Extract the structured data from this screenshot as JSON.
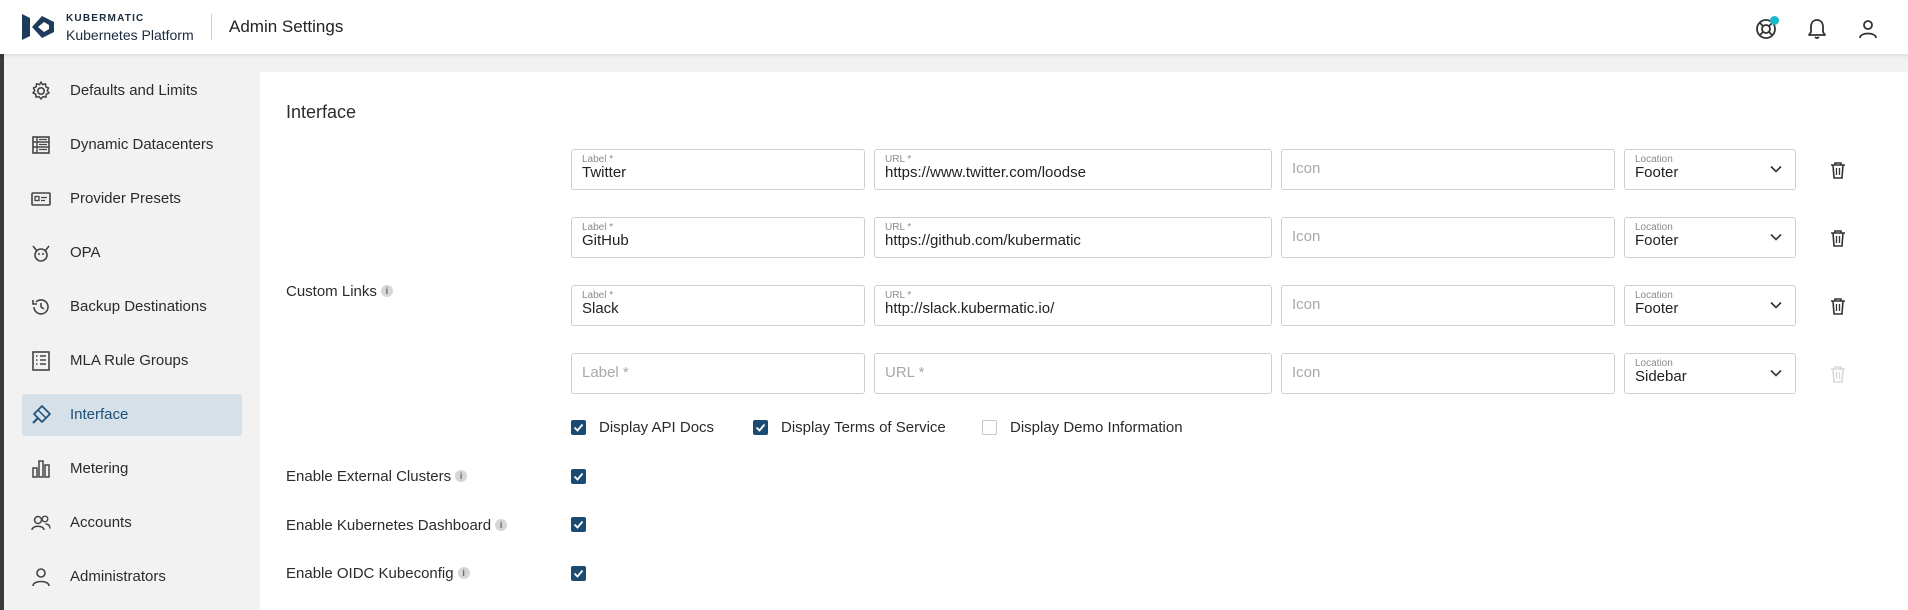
{
  "header": {
    "brand_top": "KUBERMATIC",
    "brand_bottom": "Kubernetes Platform",
    "title": "Admin Settings",
    "icons": [
      "help-icon",
      "notifications-icon",
      "account-icon"
    ]
  },
  "sidebar": {
    "items": [
      {
        "label": "Defaults and Limits",
        "icon": "gear-icon"
      },
      {
        "label": "Dynamic Datacenters",
        "icon": "datacenter-icon"
      },
      {
        "label": "Provider Presets",
        "icon": "preset-card-icon"
      },
      {
        "label": "OPA",
        "icon": "opa-icon"
      },
      {
        "label": "Backup Destinations",
        "icon": "history-icon"
      },
      {
        "label": "MLA Rule Groups",
        "icon": "list-icon"
      },
      {
        "label": "Interface",
        "icon": "brush-icon"
      },
      {
        "label": "Metering",
        "icon": "bar-chart-icon"
      },
      {
        "label": "Accounts",
        "icon": "users-icon"
      },
      {
        "label": "Administrators",
        "icon": "user-icon"
      }
    ],
    "active": "Interface"
  },
  "main": {
    "section_title": "Interface",
    "custom_links_label": "Custom Links",
    "field_labels": {
      "label": "Label *",
      "url": "URL *",
      "icon": "Icon",
      "location": "Location"
    },
    "links": [
      {
        "label": "Twitter",
        "url": "https://www.twitter.com/loodse",
        "icon": "",
        "location": "Footer"
      },
      {
        "label": "GitHub",
        "url": "https://github.com/kubermatic",
        "icon": "",
        "location": "Footer"
      },
      {
        "label": "Slack",
        "url": "http://slack.kubermatic.io/",
        "icon": "",
        "location": "Footer"
      },
      {
        "label": "",
        "url": "",
        "icon": "",
        "location": "Sidebar"
      }
    ],
    "display_options": [
      {
        "label": "Display API Docs",
        "checked": true
      },
      {
        "label": "Display Terms of Service",
        "checked": true
      },
      {
        "label": "Display Demo Information",
        "checked": false
      }
    ],
    "settings": [
      {
        "label": "Enable External Clusters",
        "checked": true
      },
      {
        "label": "Enable Kubernetes Dashboard",
        "checked": true
      },
      {
        "label": "Enable OIDC Kubeconfig",
        "checked": true
      }
    ]
  },
  "colors": {
    "accent": "#1b4b72",
    "active_bg": "#d5e0e9",
    "notification_dot": "#17b8c9"
  }
}
